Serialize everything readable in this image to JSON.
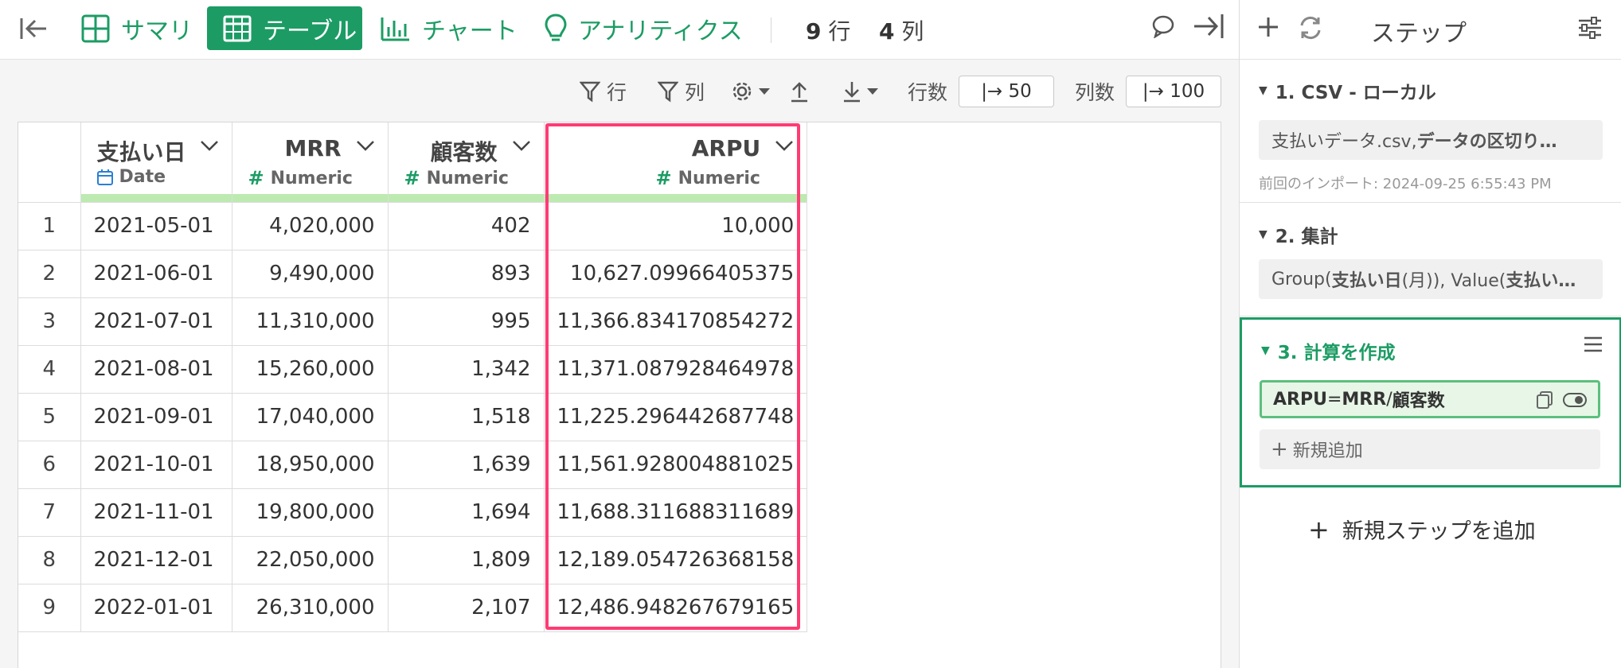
{
  "topbar": {
    "tabs": [
      {
        "label": "サマリ"
      },
      {
        "label": "テーブル"
      },
      {
        "label": "チャート"
      },
      {
        "label": "アナリティクス"
      }
    ],
    "rows_count": "9",
    "rows_unit": "行",
    "cols_count": "4",
    "cols_unit": "列"
  },
  "toolbar": {
    "filter_rows_label": "行",
    "filter_cols_label": "列",
    "rows_limit_label": "行数",
    "rows_limit_value": "|→ 50",
    "cols_limit_label": "列数",
    "cols_limit_value": "|→ 100"
  },
  "table": {
    "columns": [
      {
        "name": "支払い日",
        "type": "Date"
      },
      {
        "name": "MRR",
        "type": "Numeric"
      },
      {
        "name": "顧客数",
        "type": "Numeric"
      },
      {
        "name": "ARPU",
        "type": "Numeric"
      }
    ],
    "rows": [
      [
        "1",
        "2021-05-01",
        "4,020,000",
        "402",
        "10,000"
      ],
      [
        "2",
        "2021-06-01",
        "9,490,000",
        "893",
        "10,627.09966405375"
      ],
      [
        "3",
        "2021-07-01",
        "11,310,000",
        "995",
        "11,366.834170854272"
      ],
      [
        "4",
        "2021-08-01",
        "15,260,000",
        "1,342",
        "11,371.087928464978"
      ],
      [
        "5",
        "2021-09-01",
        "17,040,000",
        "1,518",
        "11,225.296442687748"
      ],
      [
        "6",
        "2021-10-01",
        "18,950,000",
        "1,639",
        "11,561.928004881025"
      ],
      [
        "7",
        "2021-11-01",
        "19,800,000",
        "1,694",
        "11,688.311688311689"
      ],
      [
        "8",
        "2021-12-01",
        "22,050,000",
        "1,809",
        "12,189.054726368158"
      ],
      [
        "9",
        "2022-01-01",
        "26,310,000",
        "2,107",
        "12,486.948267679165"
      ]
    ]
  },
  "panel": {
    "title": "ステップ",
    "steps": [
      {
        "title": "1. CSV - ローカル",
        "body_a": "支払いデータ.csv, ",
        "body_b": "データの区切り…",
        "meta": "前回のインポート: 2024-09-25 6:55:43 PM"
      },
      {
        "title": "2. 集計",
        "body_a": "Group(",
        "body_b": "支払い日",
        "body_c": " (月)), Value(",
        "body_d": "支払い…"
      },
      {
        "title": "3. 計算を作成",
        "calc_a": "ARPU",
        "calc_b": " = ",
        "calc_c": "MRR",
        "calc_d": " / ",
        "calc_e": "顧客数",
        "new_add": "新規追加"
      }
    ],
    "add_step_label": "新規ステップを追加"
  },
  "colors": {
    "accent": "#1c9c64",
    "highlight": "#ff3b74",
    "type_bar": "#bdeab0"
  }
}
